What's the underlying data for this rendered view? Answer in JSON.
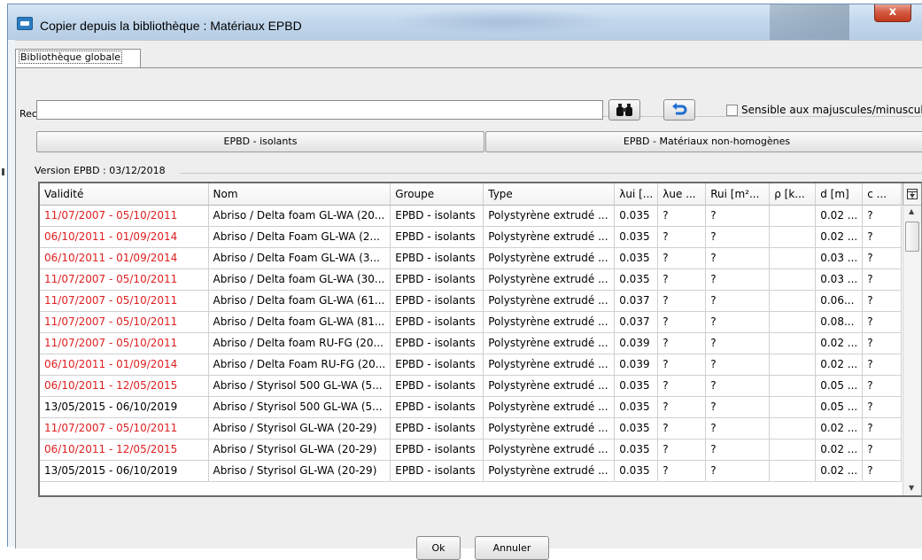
{
  "window": {
    "title": "Copier depuis la bibliothèque : Matériaux EPBD",
    "close_label": "x"
  },
  "tabs": [
    {
      "label": "Bibliothèque globale",
      "selected": true
    }
  ],
  "search": {
    "group_label": "Recherche",
    "value": "",
    "search_icon": "binoculars-icon",
    "reset_icon": "undo-arrow-icon",
    "case_checkbox_label": "Sensible aux majuscules/minuscules",
    "case_checked": false
  },
  "filters": {
    "isolants_label": "EPBD - isolants",
    "non_homogenes_label": "EPBD - Matériaux non-homogènes"
  },
  "version_label": "Version EPBD : 03/12/2018",
  "table": {
    "columns": [
      "Validité",
      "Nom",
      "Groupe",
      "Type",
      "λui [...",
      "λue ...",
      "Rui [m²...",
      "ρ [k...",
      "d [m]",
      "c ..."
    ],
    "rows": [
      {
        "validite": "11/07/2007 - 05/10/2011",
        "expired": true,
        "nom": "Abriso / Delta foam GL-WA (20...",
        "groupe": "EPBD - isolants",
        "type": "Polystyrène extrudé ...",
        "lui": "0.035",
        "lue": "?",
        "rui": "?",
        "rho": "",
        "d": "0.02 ...",
        "c": "?"
      },
      {
        "validite": "06/10/2011 - 01/09/2014",
        "expired": true,
        "nom": "Abriso / Delta Foam GL-WA (2...",
        "groupe": "EPBD - isolants",
        "type": "Polystyrène extrudé ...",
        "lui": "0.035",
        "lue": "?",
        "rui": "?",
        "rho": "",
        "d": "0.02 ...",
        "c": "?"
      },
      {
        "validite": "06/10/2011 - 01/09/2014",
        "expired": true,
        "nom": "Abriso / Delta Foam GL-WA (3...",
        "groupe": "EPBD - isolants",
        "type": "Polystyrène extrudé ...",
        "lui": "0.035",
        "lue": "?",
        "rui": "?",
        "rho": "",
        "d": "0.03 ...",
        "c": "?"
      },
      {
        "validite": "11/07/2007 - 05/10/2011",
        "expired": true,
        "nom": "Abriso / Delta foam GL-WA (30...",
        "groupe": "EPBD - isolants",
        "type": "Polystyrène extrudé ...",
        "lui": "0.035",
        "lue": "?",
        "rui": "?",
        "rho": "",
        "d": "0.03 ...",
        "c": "?"
      },
      {
        "validite": "11/07/2007 - 05/10/2011",
        "expired": true,
        "nom": "Abriso / Delta foam GL-WA (61...",
        "groupe": "EPBD - isolants",
        "type": "Polystyrène extrudé ...",
        "lui": "0.037",
        "lue": "?",
        "rui": "?",
        "rho": "",
        "d": "0.06...",
        "c": "?"
      },
      {
        "validite": "11/07/2007 - 05/10/2011",
        "expired": true,
        "nom": "Abriso / Delta foam GL-WA (81...",
        "groupe": "EPBD - isolants",
        "type": "Polystyrène extrudé ...",
        "lui": "0.037",
        "lue": "?",
        "rui": "?",
        "rho": "",
        "d": "0.08...",
        "c": "?"
      },
      {
        "validite": "11/07/2007 - 05/10/2011",
        "expired": true,
        "nom": "Abriso / Delta foam RU-FG (20...",
        "groupe": "EPBD - isolants",
        "type": "Polystyrène extrudé ...",
        "lui": "0.039",
        "lue": "?",
        "rui": "?",
        "rho": "",
        "d": "0.02 ...",
        "c": "?"
      },
      {
        "validite": "06/10/2011 - 01/09/2014",
        "expired": true,
        "nom": "Abriso / Delta Foam RU-FG (20...",
        "groupe": "EPBD - isolants",
        "type": "Polystyrène extrudé ...",
        "lui": "0.039",
        "lue": "?",
        "rui": "?",
        "rho": "",
        "d": "0.02 ...",
        "c": "?"
      },
      {
        "validite": "06/10/2011 - 12/05/2015",
        "expired": true,
        "nom": "Abriso / Styrisol 500 GL-WA (5...",
        "groupe": "EPBD - isolants",
        "type": "Polystyrène extrudé ...",
        "lui": "0.035",
        "lue": "?",
        "rui": "?",
        "rho": "",
        "d": "0.05 ...",
        "c": "?"
      },
      {
        "validite": "13/05/2015 - 06/10/2019",
        "expired": false,
        "nom": "Abriso / Styrisol 500 GL-WA (5...",
        "groupe": "EPBD - isolants",
        "type": "Polystyrène extrudé ...",
        "lui": "0.035",
        "lue": "?",
        "rui": "?",
        "rho": "",
        "d": "0.05 ...",
        "c": "?"
      },
      {
        "validite": "11/07/2007 - 05/10/2011",
        "expired": true,
        "nom": "Abriso / Styrisol GL-WA (20-29)",
        "groupe": "EPBD - isolants",
        "type": "Polystyrène extrudé ...",
        "lui": "0.035",
        "lue": "?",
        "rui": "?",
        "rho": "",
        "d": "0.02 ...",
        "c": "?"
      },
      {
        "validite": "06/10/2011 - 12/05/2015",
        "expired": true,
        "nom": "Abriso / Styrisol GL-WA (20-29)",
        "groupe": "EPBD - isolants",
        "type": "Polystyrène extrudé ...",
        "lui": "0.035",
        "lue": "?",
        "rui": "?",
        "rho": "",
        "d": "0.02 ...",
        "c": "?"
      },
      {
        "validite": "13/05/2015 - 06/10/2019",
        "expired": false,
        "nom": "Abriso / Styrisol GL-WA (20-29)",
        "groupe": "EPBD - isolants",
        "type": "Polystyrène extrudé ...",
        "lui": "0.035",
        "lue": "?",
        "rui": "?",
        "rho": "",
        "d": "0.02 ...",
        "c": "?"
      }
    ]
  },
  "buttons": {
    "ok_label": "Ok",
    "cancel_label": "Annuler"
  },
  "colors": {
    "expired_text": "#e02020",
    "title_bar": "#c4d8ec",
    "close_button": "#c2381d"
  }
}
